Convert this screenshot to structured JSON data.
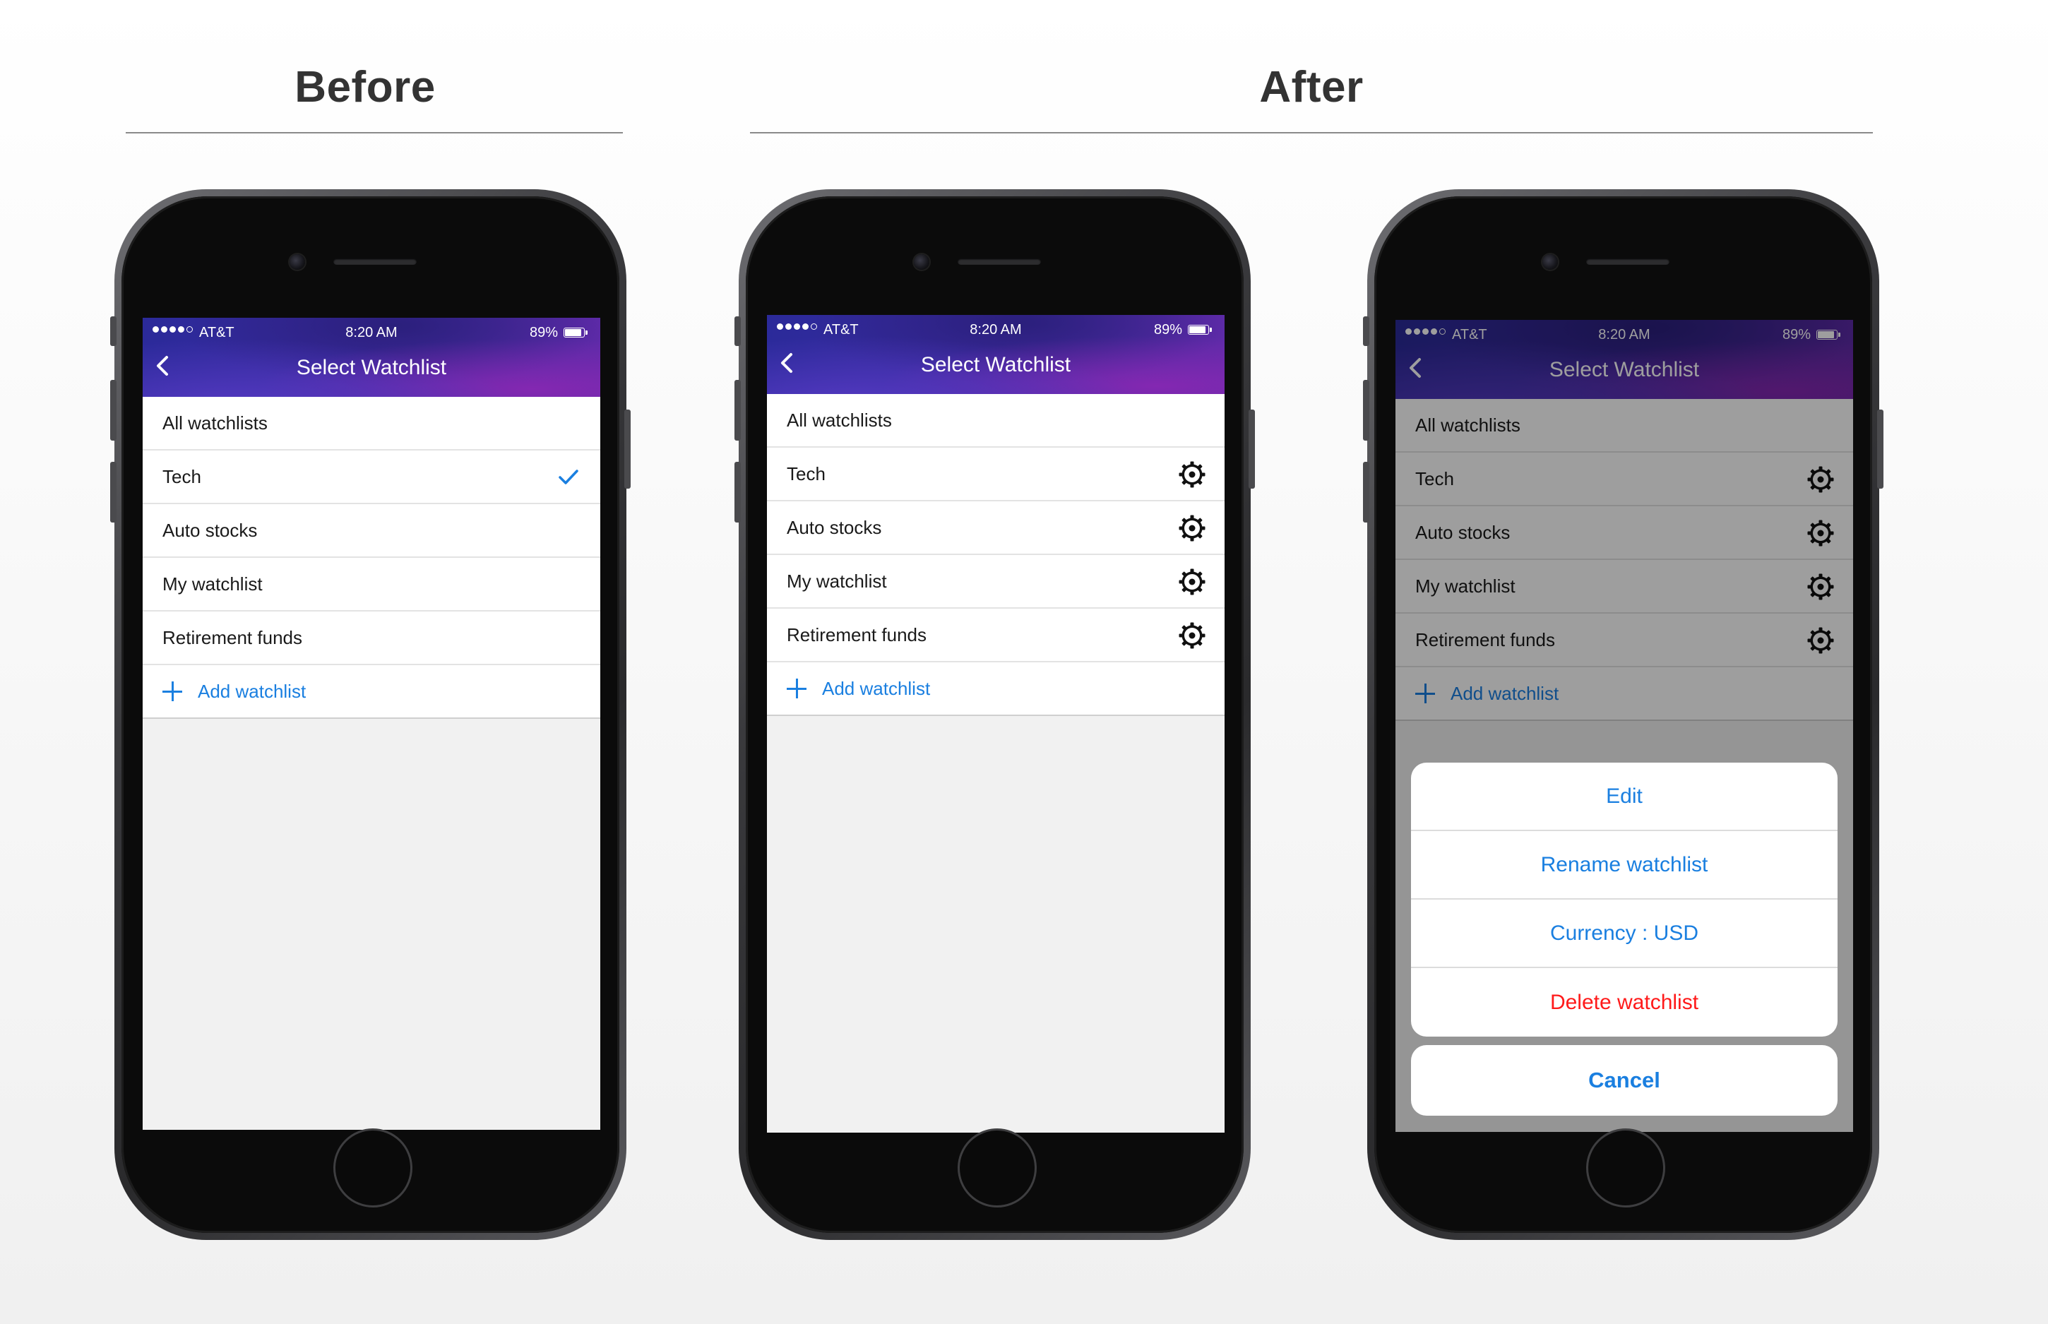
{
  "headings": {
    "before": "Before",
    "after": "After"
  },
  "status": {
    "carrier": "AT&T",
    "time": "8:20 AM",
    "battery": "89%"
  },
  "nav": {
    "title": "Select Watchlist"
  },
  "watchlists": [
    "All watchlists",
    "Tech",
    "Auto stocks",
    "My watchlist",
    "Retirement funds"
  ],
  "add_label": "Add watchlist",
  "selected": "Tech",
  "action_sheet": {
    "items": [
      "Edit",
      "Rename watchlist",
      "Currency : USD"
    ],
    "delete": "Delete watchlist",
    "cancel": "Cancel"
  },
  "colors": {
    "accent": "#1a7fe0",
    "danger": "#ff1a1a",
    "nav_start": "#2b2a9a",
    "nav_end": "#5e2aa8"
  },
  "icons": {
    "back": "chevron-left-icon",
    "selected": "checkmark-icon",
    "settings": "gear-icon",
    "add": "plus-icon"
  }
}
